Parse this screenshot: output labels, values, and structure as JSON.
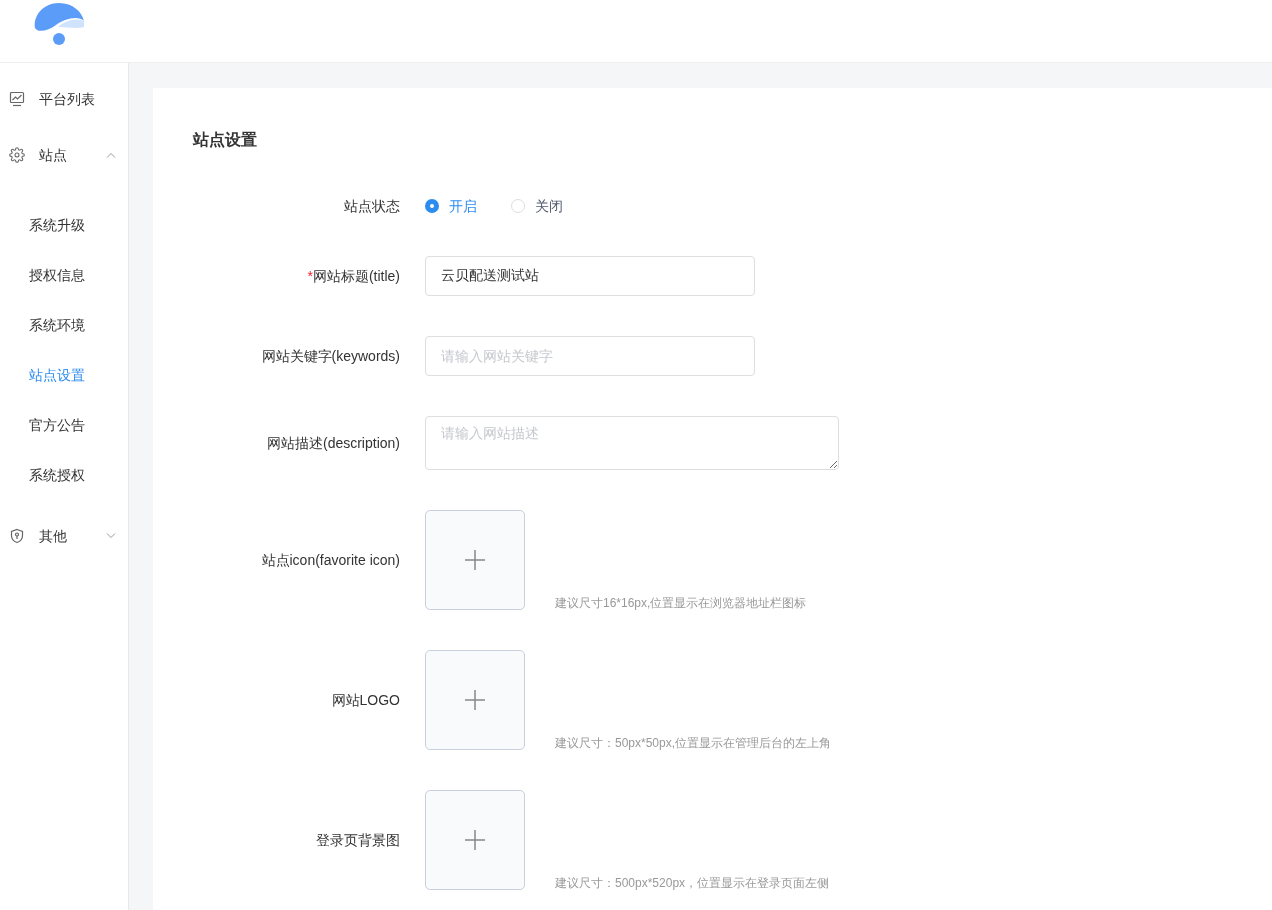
{
  "sidebar": {
    "items": [
      {
        "label": "平台列表"
      },
      {
        "label": "站点",
        "expanded": true,
        "children": [
          {
            "label": "系统升级",
            "selected": false
          },
          {
            "label": "授权信息",
            "selected": false
          },
          {
            "label": "系统环境",
            "selected": false
          },
          {
            "label": "站点设置",
            "selected": true
          },
          {
            "label": "官方公告",
            "selected": false
          },
          {
            "label": "系统授权",
            "selected": false
          }
        ]
      },
      {
        "label": "其他",
        "expanded": false
      }
    ]
  },
  "page": {
    "title": "站点设置",
    "fields": [
      {
        "kind": "radio",
        "label": "站点状态",
        "options": [
          {
            "label": "开启",
            "selected": true
          },
          {
            "label": "关闭",
            "selected": false
          }
        ]
      },
      {
        "kind": "text",
        "label": "网站标题(title)",
        "required_mark": "*",
        "value": "云贝配送测试站"
      },
      {
        "kind": "text",
        "label": "网站关键字(keywords)",
        "placeholder": "请输入网站关键字"
      },
      {
        "kind": "textarea",
        "label": "网站描述(description)",
        "placeholder": "请输入网站描述"
      },
      {
        "kind": "upload",
        "label": "站点icon(favorite icon)",
        "hint": "建议尺寸16*16px,位置显示在浏览器地址栏图标"
      },
      {
        "kind": "upload",
        "label": "网站LOGO",
        "hint": "建议尺寸：50px*50px,位置显示在管理后台的左上角"
      },
      {
        "kind": "upload",
        "label": "登录页背景图",
        "hint": "建议尺寸：500px*520px，位置显示在登录页面左侧"
      }
    ]
  }
}
